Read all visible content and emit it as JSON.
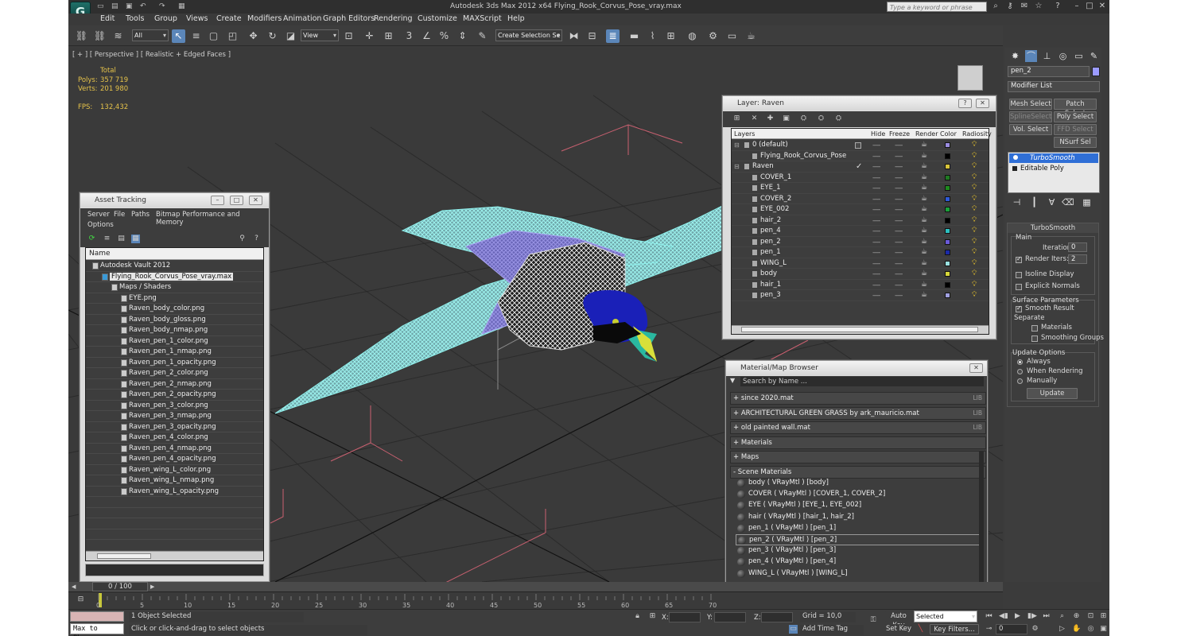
{
  "title": "Autodesk 3ds Max  2012 x64      Flying_Rook_Corvus_Pose_vray.max",
  "search_placeholder": "Type a keyword or phrase",
  "menus": [
    "Edit",
    "Tools",
    "Group",
    "Views",
    "Create",
    "Modifiers",
    "Animation",
    "Graph Editors",
    "Rendering",
    "Customize",
    "MAXScript",
    "Help"
  ],
  "toolbar": {
    "filter": "All",
    "ref_coord": "View",
    "selection_set": "Create Selection Se"
  },
  "viewport": {
    "label": "[ + ] [ Perspective ] [ Realistic + Edged Faces ]",
    "stats_header": "Total",
    "polys_label": "Polys:",
    "polys": "357 719",
    "verts_label": "Verts:",
    "verts": "201 980",
    "fps_label": "FPS:",
    "fps": "132,432"
  },
  "asset": {
    "title": "Asset Tracking",
    "menus": [
      "Server",
      "File",
      "Paths",
      "Bitmap Performance and Memory",
      "Options"
    ],
    "col_name": "Name",
    "vault": "Autodesk Vault 2012",
    "file": "Flying_Rook_Corvus_Pose_vray.max",
    "maps": "Maps / Shaders",
    "items": [
      "EYE.png",
      "Raven_body_color.png",
      "Raven_body_gloss.png",
      "Raven_body_nmap.png",
      "Raven_pen_1_color.png",
      "Raven_pen_1_nmap.png",
      "Raven_pen_1_opacity.png",
      "Raven_pen_2_color.png",
      "Raven_pen_2_nmap.png",
      "Raven_pen_2_opacity.png",
      "Raven_pen_3_color.png",
      "Raven_pen_3_nmap.png",
      "Raven_pen_3_opacity.png",
      "Raven_pen_4_color.png",
      "Raven_pen_4_nmap.png",
      "Raven_pen_4_opacity.png",
      "Raven_wing_L_color.png",
      "Raven_wing_L_nmap.png",
      "Raven_wing_L_opacity.png"
    ]
  },
  "layer": {
    "title": "Layer: Raven",
    "cols": {
      "layers": "Layers",
      "hide": "Hide",
      "freeze": "Freeze",
      "render": "Render",
      "color": "Color",
      "radiosity": "Radiosity"
    },
    "rows": [
      {
        "name": "0 (default)",
        "level": 0,
        "color": "#9a8ce0"
      },
      {
        "name": "Flying_Rook_Corvus_Pose",
        "level": 1,
        "color": "#000000"
      },
      {
        "name": "Raven",
        "level": 0,
        "color": "#d7c43a"
      },
      {
        "name": "COVER_1",
        "level": 1,
        "color": "#1f7a22"
      },
      {
        "name": "EYE_1",
        "level": 1,
        "color": "#1e8a1e"
      },
      {
        "name": "COVER_2",
        "level": 1,
        "color": "#2e5ad8"
      },
      {
        "name": "EYE_002",
        "level": 1,
        "color": "#1aa03a"
      },
      {
        "name": "hair_2",
        "level": 1,
        "color": "#000000"
      },
      {
        "name": "pen_4",
        "level": 1,
        "color": "#2cc0c0"
      },
      {
        "name": "pen_2",
        "level": 1,
        "color": "#6a5ad8"
      },
      {
        "name": "pen_1",
        "level": 1,
        "color": "#1a2aa8"
      },
      {
        "name": "WING_L",
        "level": 1,
        "color": "#9ae0e0"
      },
      {
        "name": "body",
        "level": 1,
        "color": "#d7d73a"
      },
      {
        "name": "hair_1",
        "level": 1,
        "color": "#000000"
      },
      {
        "name": "pen_3",
        "level": 1,
        "color": "#a0a0e0"
      }
    ]
  },
  "mat": {
    "title": "Material/Map Browser",
    "search": "Search by Name ...",
    "libs": [
      {
        "name": "+ since 2020.mat",
        "tag": "LIB"
      },
      {
        "name": "+ ARCHITECTURAL GREEN GRASS by ark_mauricio.mat",
        "tag": "LIB"
      },
      {
        "name": "+ old painted wall.mat",
        "tag": "LIB"
      },
      {
        "name": "+ Materials",
        "tag": ""
      },
      {
        "name": "+ Maps",
        "tag": ""
      },
      {
        "name": "- Scene Materials",
        "tag": ""
      }
    ],
    "scene": [
      "body  ( VRayMtl )  [body]",
      "COVER  ( VRayMtl )  [COVER_1, COVER_2]",
      "EYE  ( VRayMtl )  [EYE_1, EYE_002]",
      "hair  ( VRayMtl )  [hair_1, hair_2]",
      "pen_1  ( VRayMtl )  [pen_1]",
      "pen_2  ( VRayMtl )  [pen_2]",
      "pen_3  ( VRayMtl )  [pen_3]",
      "pen_4  ( VRayMtl )  [pen_4]",
      "WING_L  ( VRayMtl )  [WING_L]"
    ]
  },
  "rp": {
    "obj_name": "pen_2",
    "obj_color": "#9b9bff",
    "modifier_list": "Modifier List",
    "btns": [
      "Mesh Select",
      "Patch Select",
      "SplineSelect",
      "Poly Select",
      "Vol. Select",
      "FFD Select",
      "NSurf Sel"
    ],
    "stack": [
      "TurboSmooth",
      "Editable Poly"
    ],
    "rollout": "TurboSmooth",
    "main": "Main",
    "iterations_label": "Iterations:",
    "iterations": "0",
    "render_iters_label": "Render Iters:",
    "render_iters": "2",
    "isoline": "Isoline Display",
    "explicit": "Explicit Normals",
    "surface": "Surface Parameters",
    "smooth": "Smooth Result",
    "separate": "Separate",
    "materials": "Materials",
    "smoothing": "Smoothing Groups",
    "update_opts": "Update Options",
    "always": "Always",
    "when_render": "When Rendering",
    "manually": "Manually",
    "update": "Update"
  },
  "timeline": {
    "frames": "0 / 100",
    "ticks": [
      "0",
      "5",
      "10",
      "15",
      "20",
      "25",
      "30",
      "35",
      "40",
      "45",
      "50",
      "55",
      "60",
      "65",
      "70"
    ]
  },
  "status": {
    "script": "Max to Physc.",
    "selected": "1 Object Selected",
    "prompt": "Click or click-and-drag to select objects",
    "x": "X:",
    "y": "Y:",
    "z": "Z:",
    "grid": "Grid = 10,0",
    "add_tag": "Add Time Tag",
    "autokey": "Auto Key",
    "setkey": "Set Key",
    "selected_dd": "Selected",
    "key_filters": "Key Filters...",
    "frame": "0"
  }
}
